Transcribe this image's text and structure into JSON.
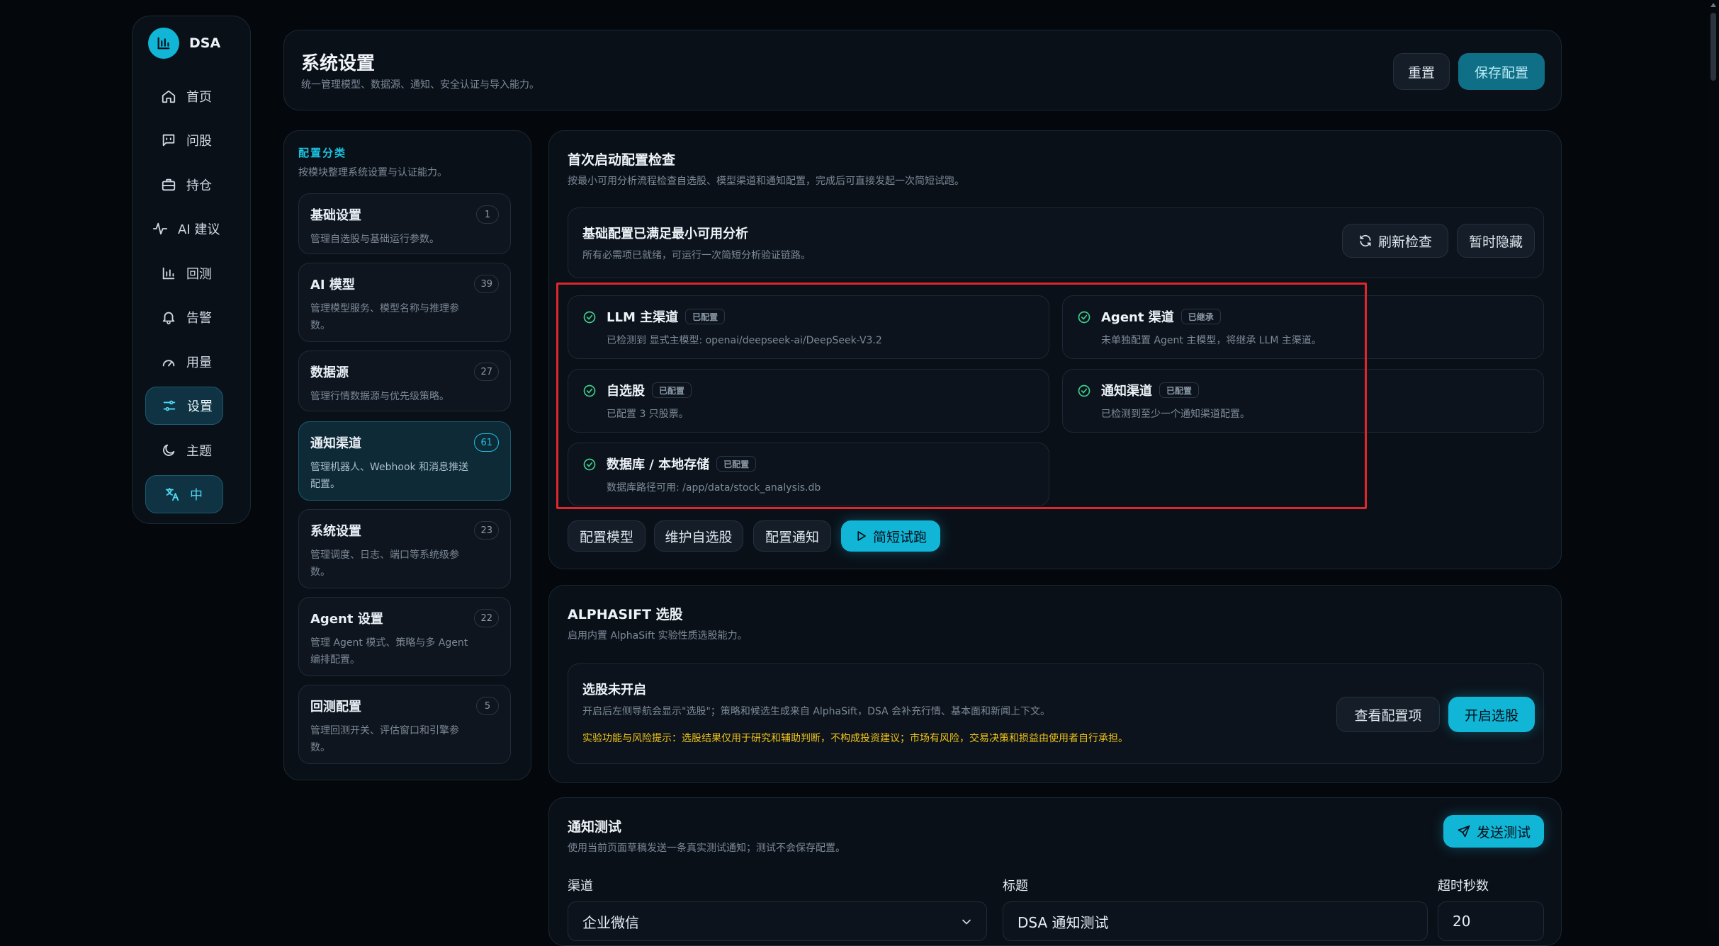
{
  "app": {
    "name": "DSA"
  },
  "nav": {
    "items": [
      {
        "label": "首页",
        "icon": "home-icon"
      },
      {
        "label": "问股",
        "icon": "chat-icon"
      },
      {
        "label": "持仓",
        "icon": "briefcase-icon"
      },
      {
        "label": "AI 建议",
        "icon": "activity-icon"
      },
      {
        "label": "回测",
        "icon": "bar-chart-icon"
      },
      {
        "label": "告警",
        "icon": "bell-icon"
      },
      {
        "label": "用量",
        "icon": "gauge-icon"
      },
      {
        "label": "设置",
        "icon": "sliders-icon"
      },
      {
        "label": "主题",
        "icon": "moon-icon"
      }
    ],
    "language_label": "中"
  },
  "header": {
    "title": "系统设置",
    "subtitle": "统一管理模型、数据源、通知、安全认证与导入能力。",
    "reset_label": "重置",
    "save_label": "保存配置"
  },
  "categories": {
    "title": "配置分类",
    "subtitle": "按模块整理系统设置与认证能力。",
    "items": [
      {
        "title": "基础设置",
        "desc": "管理自选股与基础运行参数。",
        "count": "1"
      },
      {
        "title": "AI 模型",
        "desc": "管理模型服务、模型名称与推理参数。",
        "count": "39"
      },
      {
        "title": "数据源",
        "desc": "管理行情数据源与优先级策略。",
        "count": "27"
      },
      {
        "title": "通知渠道",
        "desc": "管理机器人、Webhook 和消息推送配置。",
        "count": "61"
      },
      {
        "title": "系统设置",
        "desc": "管理调度、日志、端口等系统级参数。",
        "count": "23"
      },
      {
        "title": "Agent 设置",
        "desc": "管理 Agent 模式、策略与多 Agent 编排配置。",
        "count": "22"
      },
      {
        "title": "回测配置",
        "desc": "管理回测开关、评估窗口和引擎参数。",
        "count": "5"
      }
    ]
  },
  "startup_check": {
    "title": "首次启动配置检查",
    "subtitle": "按最小可用分析流程检查自选股、模型渠道和通知配置，完成后可直接发起一次简短试跑。",
    "status_title": "基础配置已满足最小可用分析",
    "status_subtitle": "所有必需项已就绪，可运行一次简短分析验证链路。",
    "refresh_label": "刷新检查",
    "hide_label": "暂时隐藏",
    "checks": [
      {
        "title": "LLM 主渠道",
        "badge": "已配置",
        "desc": "已检测到 显式主模型: openai/deepseek-ai/DeepSeek-V3.2"
      },
      {
        "title": "Agent 渠道",
        "badge": "已继承",
        "desc": "未单独配置 Agent 主模型，将继承 LLM 主渠道。"
      },
      {
        "title": "自选股",
        "badge": "已配置",
        "desc": "已配置 3 只股票。"
      },
      {
        "title": "通知渠道",
        "badge": "已配置",
        "desc": "已检测到至少一个通知渠道配置。"
      },
      {
        "title": "数据库 / 本地存储",
        "badge": "已配置",
        "desc": "数据库路径可用: /app/data/stock_analysis.db"
      }
    ],
    "actions": {
      "config_model": "配置模型",
      "maintain_watchlist": "维护自选股",
      "config_notify": "配置通知",
      "trial_run": "简短试跑"
    }
  },
  "alphasift": {
    "title": "ALPHASIFT 选股",
    "subtitle": "启用内置 AlphaSift 实验性质选股能力。",
    "status_title": "选股未开启",
    "status_desc": "开启后左侧导航会显示\"选股\"；策略和候选生成来自 AlphaSift，DSA 会补充行情、基本面和新闻上下文。",
    "warning": "实验功能与风险提示：选股结果仅用于研究和辅助判断，不构成投资建议；市场有风险，交易决策和损益由使用者自行承担。",
    "view_config_label": "查看配置项",
    "enable_label": "开启选股"
  },
  "notify_test": {
    "title": "通知测试",
    "subtitle": "使用当前页面草稿发送一条真实测试通知；测试不会保存配置。",
    "send_label": "发送测试",
    "channel_label": "渠道",
    "channel_value": "企业微信",
    "subject_label": "标题",
    "subject_value": "DSA 通知测试",
    "timeout_label": "超时秒数",
    "timeout_value": "20"
  },
  "colors": {
    "accent": "#11b5d6",
    "success": "#3ecf8e",
    "warning": "#f0c419",
    "highlight": "#e0262d"
  }
}
